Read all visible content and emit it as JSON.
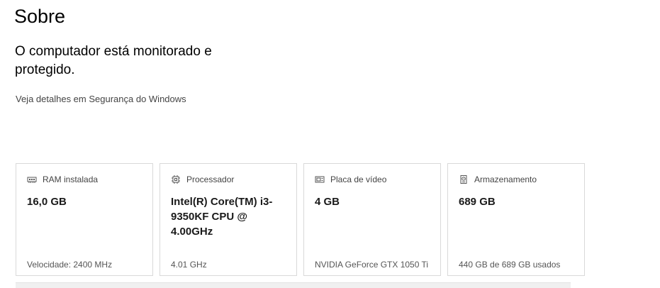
{
  "header": {
    "title": "Sobre"
  },
  "security": {
    "status": "O computador está monitorado e protegido.",
    "link": "Veja detalhes em Segurança do Windows"
  },
  "cards": [
    {
      "icon": "ram-icon",
      "label": "RAM instalada",
      "value": "16,0 GB",
      "footer": "Velocidade: 2400 MHz"
    },
    {
      "icon": "processor-icon",
      "label": "Processador",
      "value": "Intel(R) Core(TM) i3-9350KF CPU @ 4.00GHz",
      "footer": "4.01 GHz"
    },
    {
      "icon": "video-card-icon",
      "label": "Placa de vídeo",
      "value": "4 GB",
      "footer": "NVIDIA GeForce GTX 1050 Ti"
    },
    {
      "icon": "storage-icon",
      "label": "Armazenamento",
      "value": "689 GB",
      "footer": "440 GB de 689 GB usados"
    }
  ]
}
